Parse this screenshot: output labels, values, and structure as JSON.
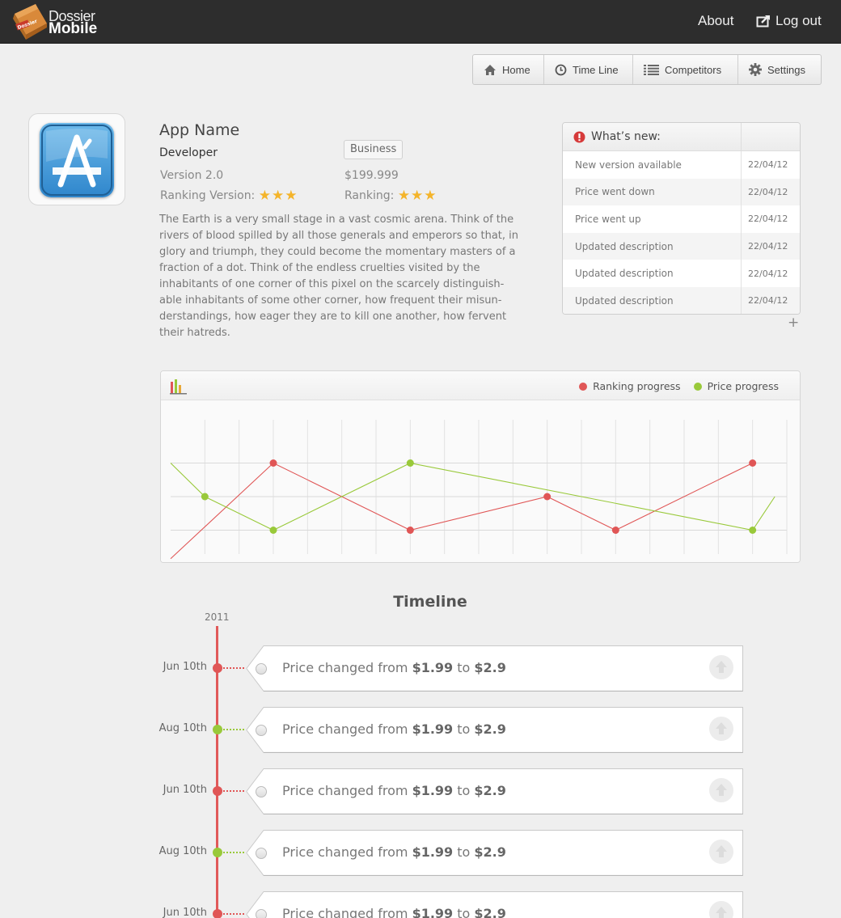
{
  "header": {
    "logo_badge": "Dossier",
    "logo_line1": "Dossier",
    "logo_line2": "Mobile",
    "about_label": "About",
    "logout_label": "Log out"
  },
  "nav": {
    "items": [
      {
        "label": "Home",
        "icon": "home-icon"
      },
      {
        "label": "Time Line",
        "icon": "clock-icon"
      },
      {
        "label": "Competitors",
        "icon": "list-icon"
      },
      {
        "label": "Settings",
        "icon": "gear-icon"
      }
    ]
  },
  "app": {
    "name": "App Name",
    "developer": "Developer",
    "category": "Business",
    "version": "Version 2.0",
    "price": "$199.999",
    "ranking_version_label": "Ranking Version:",
    "ranking_version_stars": 3,
    "ranking_label": "Ranking:",
    "ranking_stars": 3,
    "description": "The Earth is a very small stage in a vast cosmic arena. Think of the rivers of blood spilled by all those generals and emperors so that, in glory and triumph, they could become the momentary masters of a fraction of a dot. Think of the endless cruelties visited by the inhabitants of one corner of this pixel on the scarcely distinguish-able inhabitants of some other corner, how frequent their misun-derstandings, how eager they are to kill one another, how fervent their hatreds."
  },
  "whats_new": {
    "title": "What’s new:",
    "rows": [
      {
        "label": "New version available",
        "date": "22/04/12"
      },
      {
        "label": "Price went down",
        "date": "22/04/12"
      },
      {
        "label": "Price went up",
        "date": "22/04/12"
      },
      {
        "label": "Updated description",
        "date": "22/04/12"
      },
      {
        "label": "Updated description",
        "date": "22/04/12"
      },
      {
        "label": "Updated description",
        "date": "22/04/12"
      }
    ],
    "more_label": "+"
  },
  "chart_data": {
    "type": "line",
    "title": "",
    "xlabel": "",
    "ylabel": "",
    "legend_position": "top-right",
    "grid": true,
    "x": [
      0,
      1,
      2,
      3,
      4,
      5,
      6,
      7,
      8,
      9,
      10,
      11,
      12,
      13,
      14,
      15,
      16,
      17,
      18
    ],
    "ylim": [
      0,
      4
    ],
    "series": [
      {
        "name": "Ranking progress",
        "color": "#e05656",
        "points": [
          [
            0,
            0.15
          ],
          [
            3,
            3
          ],
          [
            7,
            1
          ],
          [
            11,
            2
          ],
          [
            13,
            1
          ],
          [
            17,
            3
          ]
        ]
      },
      {
        "name": "Price progress",
        "color": "#99c93a",
        "points": [
          [
            0,
            3
          ],
          [
            1,
            2
          ],
          [
            3,
            1
          ],
          [
            7,
            3
          ],
          [
            17,
            1
          ],
          [
            17.65,
            2
          ]
        ]
      }
    ]
  },
  "timeline": {
    "title": "Timeline",
    "year": "2011",
    "events": [
      {
        "date": "Jun 10th",
        "color": "#e05656",
        "prefix": "Price changed from ",
        "from": "$1.99",
        "mid": " to ",
        "to": "$2.9"
      },
      {
        "date": "Aug 10th",
        "color": "#99c93a",
        "prefix": "Price changed from ",
        "from": "$1.99",
        "mid": " to ",
        "to": "$2.9"
      },
      {
        "date": "Jun 10th",
        "color": "#e05656",
        "prefix": "Price changed from ",
        "from": "$1.99",
        "mid": " to ",
        "to": "$2.9"
      },
      {
        "date": "Aug 10th",
        "color": "#99c93a",
        "prefix": "Price changed from ",
        "from": "$1.99",
        "mid": " to ",
        "to": "$2.9"
      },
      {
        "date": "Jun 10th",
        "color": "#e05656",
        "prefix": "Price changed from ",
        "from": "$1.99",
        "mid": " to ",
        "to": "$2.9"
      }
    ]
  }
}
